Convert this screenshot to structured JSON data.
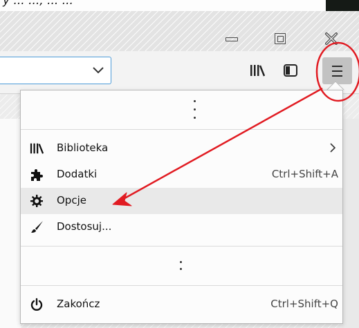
{
  "top_strip": {
    "cropped_text": "y ... ..., ... ..."
  },
  "window_controls": {
    "minimize_icon": "minimize-icon",
    "maximize_icon": "maximize-icon",
    "close_icon": "close-icon"
  },
  "toolbar": {
    "url_dropdown_icon": "chevron-down-icon",
    "library_icon": "library-icon",
    "sidebar_icon": "sidebar-icon",
    "menu_icon": "hamburger-menu-icon"
  },
  "menu": {
    "items": [
      {
        "label": "Biblioteka",
        "shortcut": "",
        "icon": "library-icon",
        "submenu": true
      },
      {
        "label": "Dodatki",
        "shortcut": "Ctrl+Shift+A",
        "icon": "puzzle-icon",
        "submenu": false
      },
      {
        "label": "Opcje",
        "shortcut": "",
        "icon": "gear-icon",
        "submenu": false,
        "highlighted": true
      },
      {
        "label": "Dostosuj...",
        "shortcut": "",
        "icon": "paintbrush-icon",
        "submenu": false
      }
    ],
    "quit": {
      "label": "Zakończ",
      "shortcut": "Ctrl+Shift+Q",
      "icon": "power-icon"
    }
  },
  "annotation": {
    "circle_color": "#e11b22",
    "arrow_color": "#e11b22"
  },
  "colors": {
    "urlbar_border": "#4a9ad8",
    "hover": "#e9e9e9"
  }
}
